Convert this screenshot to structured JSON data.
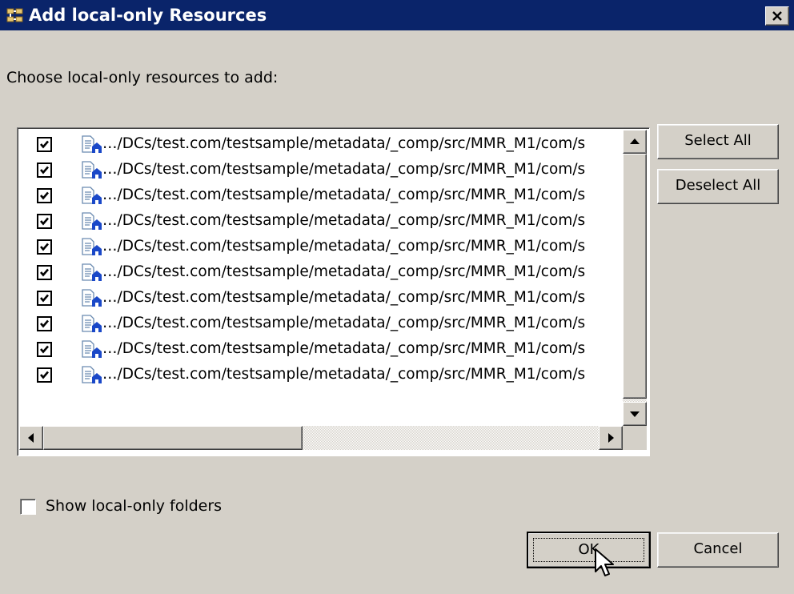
{
  "window": {
    "title": "Add local-only Resources",
    "icon": "app-resources-icon",
    "close_icon": "close-icon"
  },
  "prompt": "Choose local-only resources to add:",
  "resources": [
    {
      "path": "…/DCs/test.com/testsample/metadata/_comp/src/MMR_M1/com/s",
      "checked": true
    },
    {
      "path": "…/DCs/test.com/testsample/metadata/_comp/src/MMR_M1/com/s",
      "checked": true
    },
    {
      "path": "…/DCs/test.com/testsample/metadata/_comp/src/MMR_M1/com/s",
      "checked": true
    },
    {
      "path": "…/DCs/test.com/testsample/metadata/_comp/src/MMR_M1/com/s",
      "checked": true
    },
    {
      "path": "…/DCs/test.com/testsample/metadata/_comp/src/MMR_M1/com/s",
      "checked": true
    },
    {
      "path": "…/DCs/test.com/testsample/metadata/_comp/src/MMR_M1/com/s",
      "checked": true
    },
    {
      "path": "…/DCs/test.com/testsample/metadata/_comp/src/MMR_M1/com/s",
      "checked": true
    },
    {
      "path": "…/DCs/test.com/testsample/metadata/_comp/src/MMR_M1/com/s",
      "checked": true
    },
    {
      "path": "…/DCs/test.com/testsample/metadata/_comp/src/MMR_M1/com/s",
      "checked": true
    },
    {
      "path": "…/DCs/test.com/testsample/metadata/_comp/src/MMR_M1/com/s",
      "checked": true
    }
  ],
  "buttons": {
    "select_all": "Select All",
    "deselect_all": "Deselect All",
    "ok": "OK",
    "cancel": "Cancel"
  },
  "show_folders": {
    "label": "Show local-only folders",
    "checked": false
  },
  "colors": {
    "titlebar": "#0a246a",
    "dialog": "#d4d0c8"
  }
}
